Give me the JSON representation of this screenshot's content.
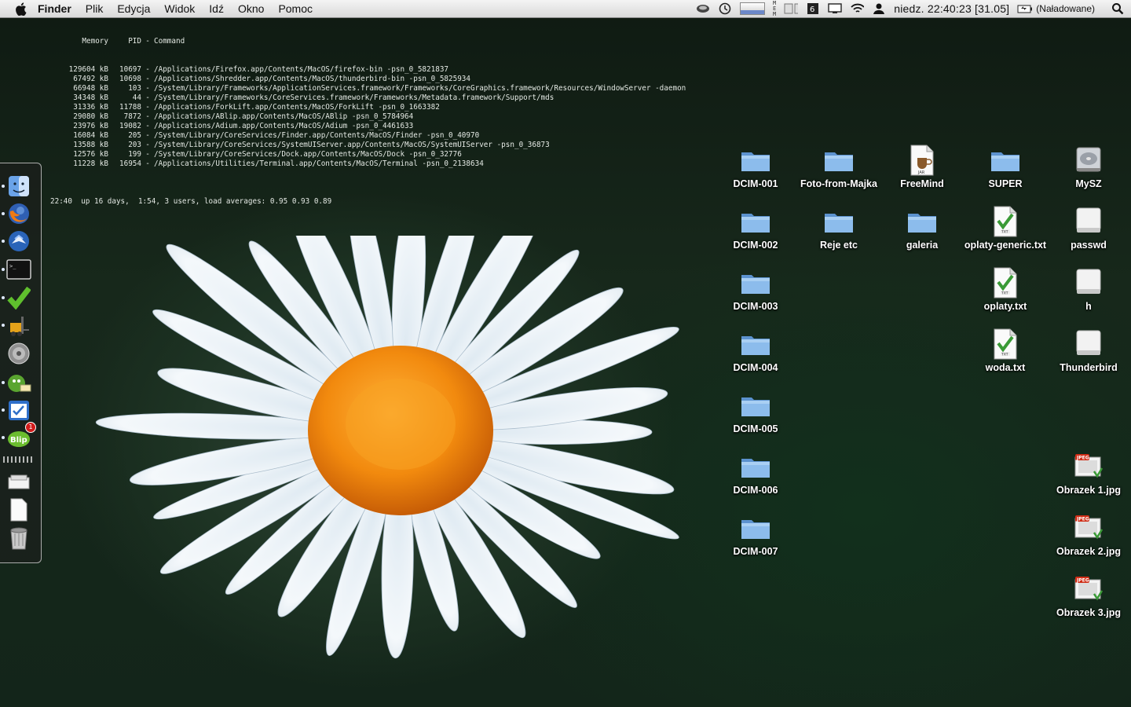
{
  "menubar": {
    "app_name": "Finder",
    "menus": [
      "Plik",
      "Edycja",
      "Widok",
      "Idź",
      "Okno",
      "Pomoc"
    ],
    "clock": "niedz. 22:40:23 [31.05]",
    "battery_label": "(Naładowane)",
    "status_icons": [
      "disk-icon",
      "time-machine-icon",
      "cpu-meter-icon",
      "mem-meter-icon",
      "disk-io-meter-icon",
      "input-menu-icon",
      "display-icon",
      "wifi-icon",
      "user-icon",
      "battery-icon",
      "spotlight-icon"
    ]
  },
  "terminal": {
    "header": {
      "mem": "Memory",
      "pid": "PID",
      "cmd": "Command"
    },
    "processes": [
      {
        "mem": "129604 kB",
        "pid": "10697",
        "cmd": "/Applications/Firefox.app/Contents/MacOS/firefox-bin -psn_0_5821837"
      },
      {
        "mem": "67492 kB",
        "pid": "10698",
        "cmd": "/Applications/Shredder.app/Contents/MacOS/thunderbird-bin -psn_0_5825934"
      },
      {
        "mem": "66948 kB",
        "pid": "103",
        "cmd": "/System/Library/Frameworks/ApplicationServices.framework/Frameworks/CoreGraphics.framework/Resources/WindowServer -daemon"
      },
      {
        "mem": "34348 kB",
        "pid": "44",
        "cmd": "/System/Library/Frameworks/CoreServices.framework/Frameworks/Metadata.framework/Support/mds"
      },
      {
        "mem": "31336 kB",
        "pid": "11788",
        "cmd": "/Applications/ForkLift.app/Contents/MacOS/ForkLift -psn_0_1663382"
      },
      {
        "mem": "29080 kB",
        "pid": "7872",
        "cmd": "/Applications/ABlip.app/Contents/MacOS/ABlip -psn_0_5784964"
      },
      {
        "mem": "23976 kB",
        "pid": "19082",
        "cmd": "/Applications/Adium.app/Contents/MacOS/Adium -psn_0_4461633"
      },
      {
        "mem": "16084 kB",
        "pid": "205",
        "cmd": "/System/Library/CoreServices/Finder.app/Contents/MacOS/Finder -psn_0_40970"
      },
      {
        "mem": "13588 kB",
        "pid": "203",
        "cmd": "/System/Library/CoreServices/SystemUIServer.app/Contents/MacOS/SystemUIServer -psn_0_36873"
      },
      {
        "mem": "12576 kB",
        "pid": "199",
        "cmd": "/System/Library/CoreServices/Dock.app/Contents/MacOS/Dock -psn_0_32776"
      },
      {
        "mem": "11228 kB",
        "pid": "16954",
        "cmd": "/Applications/Utilities/Terminal.app/Contents/MacOS/Terminal -psn_0_2138634"
      }
    ],
    "uptime": "22:40  up 16 days,  1:54, 3 users, load averages: 0.95 0.93 0.89"
  },
  "dock": {
    "items": [
      {
        "name": "finder-icon",
        "running": true
      },
      {
        "name": "firefox-icon",
        "running": true
      },
      {
        "name": "thunderbird-icon",
        "running": true
      },
      {
        "name": "terminal-icon",
        "running": true
      },
      {
        "name": "checkmark-app-icon",
        "running": true
      },
      {
        "name": "forklift-icon",
        "running": true
      },
      {
        "name": "system-preferences-icon",
        "running": false
      },
      {
        "name": "adium-icon",
        "running": true
      },
      {
        "name": "todo-app-icon",
        "running": true
      },
      {
        "name": "ablip-icon",
        "running": true,
        "badge": "1"
      },
      {
        "name": "downloads-stack-icon",
        "running": false
      },
      {
        "name": "documents-stack-icon",
        "running": false
      },
      {
        "name": "trash-icon",
        "running": false
      }
    ]
  },
  "desktop": {
    "icons": [
      {
        "label": "DCIM-001",
        "type": "folder"
      },
      {
        "label": "Foto-from-Majka",
        "type": "folder"
      },
      {
        "label": "FreeMind",
        "type": "jar"
      },
      {
        "label": "SUPER",
        "type": "folder"
      },
      {
        "label": "MySZ",
        "type": "drive"
      },
      {
        "label": "DCIM-002",
        "type": "folder"
      },
      {
        "label": "Reje etc",
        "type": "folder"
      },
      {
        "label": "galeria",
        "type": "folder"
      },
      {
        "label": "oplaty-generic.txt",
        "type": "txt"
      },
      {
        "label": "passwd",
        "type": "blank"
      },
      {
        "label": "DCIM-003",
        "type": "folder"
      },
      {
        "label": "oplaty.txt",
        "type": "txt"
      },
      {
        "label": "h",
        "type": "blank"
      },
      {
        "label": "DCIM-004",
        "type": "folder"
      },
      {
        "label": "woda.txt",
        "type": "txt"
      },
      {
        "label": "Thunderbird",
        "type": "blank"
      },
      {
        "label": "DCIM-005",
        "type": "folder"
      },
      {
        "label": "DCIM-006",
        "type": "folder"
      },
      {
        "label": "Obrazek 1.jpg",
        "type": "jpeg"
      },
      {
        "label": "DCIM-007",
        "type": "folder"
      },
      {
        "label": "Obrazek 2.jpg",
        "type": "jpeg"
      },
      {
        "label": "Obrazek 3.jpg",
        "type": "jpeg"
      }
    ]
  },
  "colors": {
    "folder": "#7fb1e6",
    "daisy_center": "#f08a0c",
    "petal": "#e9f1f7",
    "wallpaper": "#17281b"
  }
}
